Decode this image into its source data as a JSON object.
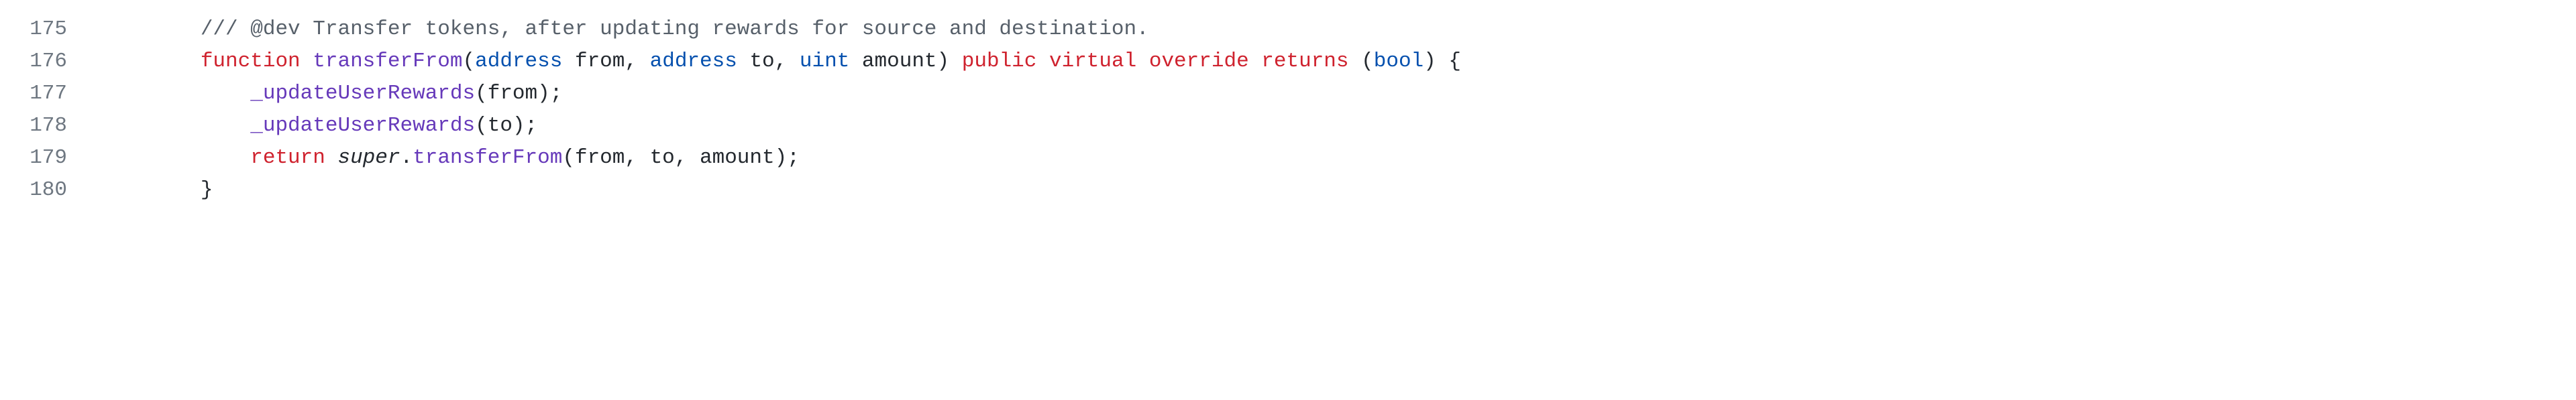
{
  "code": {
    "lines": [
      {
        "num": "175",
        "indent": "        ",
        "tokens": [
          {
            "cls": "tok-comment",
            "text": "/// @dev Transfer tokens, after updating rewards for source and destination."
          }
        ]
      },
      {
        "num": "176",
        "indent": "        ",
        "tokens": [
          {
            "cls": "tok-keyword",
            "text": "function"
          },
          {
            "cls": "tok-plain",
            "text": " "
          },
          {
            "cls": "tok-func",
            "text": "transferFrom"
          },
          {
            "cls": "tok-punct",
            "text": "("
          },
          {
            "cls": "tok-type",
            "text": "address"
          },
          {
            "cls": "tok-plain",
            "text": " "
          },
          {
            "cls": "tok-param",
            "text": "from"
          },
          {
            "cls": "tok-punct",
            "text": ", "
          },
          {
            "cls": "tok-type",
            "text": "address"
          },
          {
            "cls": "tok-plain",
            "text": " "
          },
          {
            "cls": "tok-param",
            "text": "to"
          },
          {
            "cls": "tok-punct",
            "text": ", "
          },
          {
            "cls": "tok-type",
            "text": "uint"
          },
          {
            "cls": "tok-plain",
            "text": " "
          },
          {
            "cls": "tok-param",
            "text": "amount"
          },
          {
            "cls": "tok-punct",
            "text": ") "
          },
          {
            "cls": "tok-keyword",
            "text": "public"
          },
          {
            "cls": "tok-plain",
            "text": " "
          },
          {
            "cls": "tok-keyword",
            "text": "virtual"
          },
          {
            "cls": "tok-plain",
            "text": " "
          },
          {
            "cls": "tok-keyword",
            "text": "override"
          },
          {
            "cls": "tok-plain",
            "text": " "
          },
          {
            "cls": "tok-keyword",
            "text": "returns"
          },
          {
            "cls": "tok-plain",
            "text": " "
          },
          {
            "cls": "tok-punct",
            "text": "("
          },
          {
            "cls": "tok-type",
            "text": "bool"
          },
          {
            "cls": "tok-punct",
            "text": ") {"
          }
        ]
      },
      {
        "num": "177",
        "indent": "            ",
        "tokens": [
          {
            "cls": "tok-func",
            "text": "_updateUserRewards"
          },
          {
            "cls": "tok-punct",
            "text": "(from);"
          }
        ]
      },
      {
        "num": "178",
        "indent": "            ",
        "tokens": [
          {
            "cls": "tok-func",
            "text": "_updateUserRewards"
          },
          {
            "cls": "tok-punct",
            "text": "(to);"
          }
        ]
      },
      {
        "num": "179",
        "indent": "            ",
        "tokens": [
          {
            "cls": "tok-keyword",
            "text": "return"
          },
          {
            "cls": "tok-plain",
            "text": " "
          },
          {
            "cls": "tok-plain italic",
            "text": "super"
          },
          {
            "cls": "tok-punct",
            "text": "."
          },
          {
            "cls": "tok-func",
            "text": "transferFrom"
          },
          {
            "cls": "tok-punct",
            "text": "(from, to, amount);"
          }
        ]
      },
      {
        "num": "180",
        "indent": "        ",
        "tokens": [
          {
            "cls": "tok-punct",
            "text": "}"
          }
        ]
      }
    ]
  }
}
